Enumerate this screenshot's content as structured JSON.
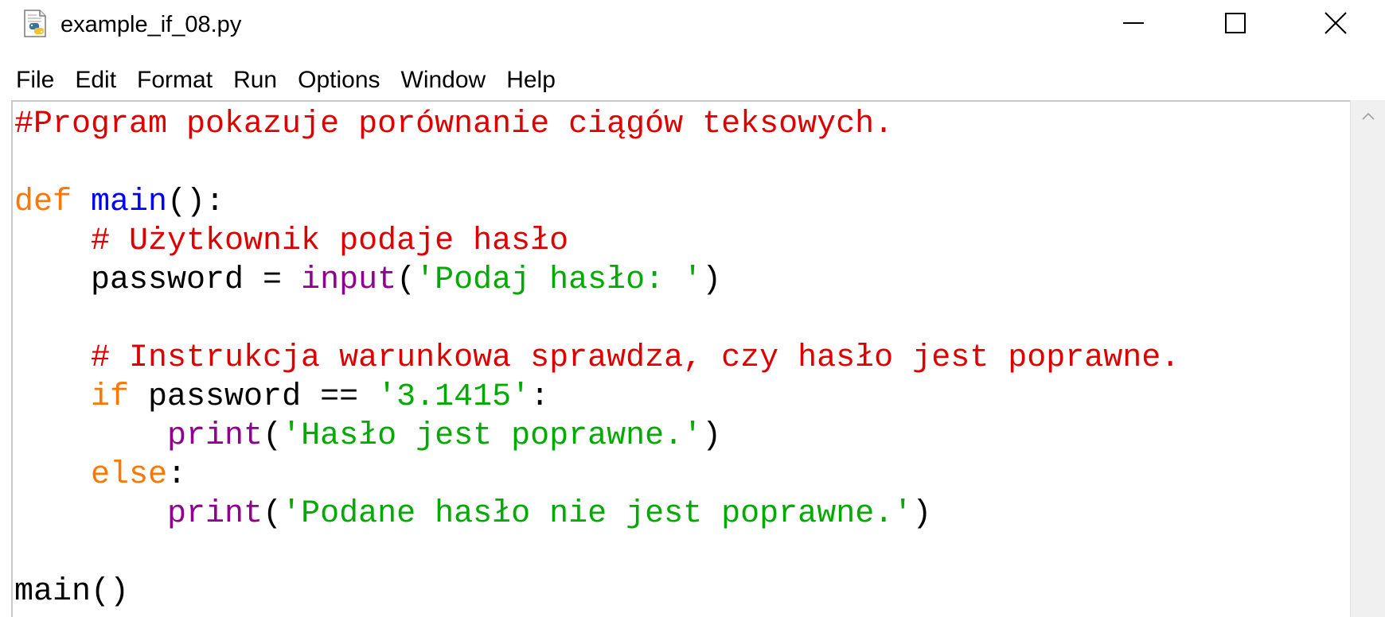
{
  "window": {
    "title": "example_if_08.py",
    "icon": "python-file-icon",
    "controls": {
      "minimize": "minimize-icon",
      "maximize": "maximize-icon",
      "close": "close-icon"
    }
  },
  "menubar": {
    "items": [
      "File",
      "Edit",
      "Format",
      "Run",
      "Options",
      "Window",
      "Help"
    ]
  },
  "editor": {
    "colors": {
      "keyword": "#ff7700",
      "definition": "#0000ff",
      "builtin": "#900090",
      "string": "#00aa00",
      "comment": "#dd0000",
      "default": "#000000"
    },
    "lines": [
      [
        {
          "t": "comment",
          "v": "#Program pokazuje porównanie ciągów teksowych."
        }
      ],
      [],
      [
        {
          "t": "kw",
          "v": "def"
        },
        {
          "t": "plain",
          "v": " "
        },
        {
          "t": "def-name",
          "v": "main"
        },
        {
          "t": "plain",
          "v": "():"
        }
      ],
      [
        {
          "t": "plain",
          "v": "    "
        },
        {
          "t": "comment",
          "v": "# Użytkownik podaje hasło"
        }
      ],
      [
        {
          "t": "plain",
          "v": "    password = "
        },
        {
          "t": "builtin",
          "v": "input"
        },
        {
          "t": "plain",
          "v": "("
        },
        {
          "t": "str",
          "v": "'Podaj hasło: '"
        },
        {
          "t": "plain",
          "v": ")"
        }
      ],
      [],
      [
        {
          "t": "plain",
          "v": "    "
        },
        {
          "t": "comment",
          "v": "# Instrukcja warunkowa sprawdza, czy hasło jest poprawne."
        }
      ],
      [
        {
          "t": "plain",
          "v": "    "
        },
        {
          "t": "kw",
          "v": "if"
        },
        {
          "t": "plain",
          "v": " password == "
        },
        {
          "t": "str",
          "v": "'3.1415'"
        },
        {
          "t": "plain",
          "v": ":"
        }
      ],
      [
        {
          "t": "plain",
          "v": "        "
        },
        {
          "t": "builtin",
          "v": "print"
        },
        {
          "t": "plain",
          "v": "("
        },
        {
          "t": "str",
          "v": "'Hasło jest poprawne.'"
        },
        {
          "t": "plain",
          "v": ")"
        }
      ],
      [
        {
          "t": "plain",
          "v": "    "
        },
        {
          "t": "kw",
          "v": "else"
        },
        {
          "t": "plain",
          "v": ":"
        }
      ],
      [
        {
          "t": "plain",
          "v": "        "
        },
        {
          "t": "builtin",
          "v": "print"
        },
        {
          "t": "plain",
          "v": "("
        },
        {
          "t": "str",
          "v": "'Podane hasło nie jest poprawne.'"
        },
        {
          "t": "plain",
          "v": ")"
        }
      ],
      [],
      [
        {
          "t": "plain",
          "v": "main()"
        }
      ]
    ]
  },
  "scrollbar": {
    "up_icon": "scroll-up-arrow-icon"
  }
}
